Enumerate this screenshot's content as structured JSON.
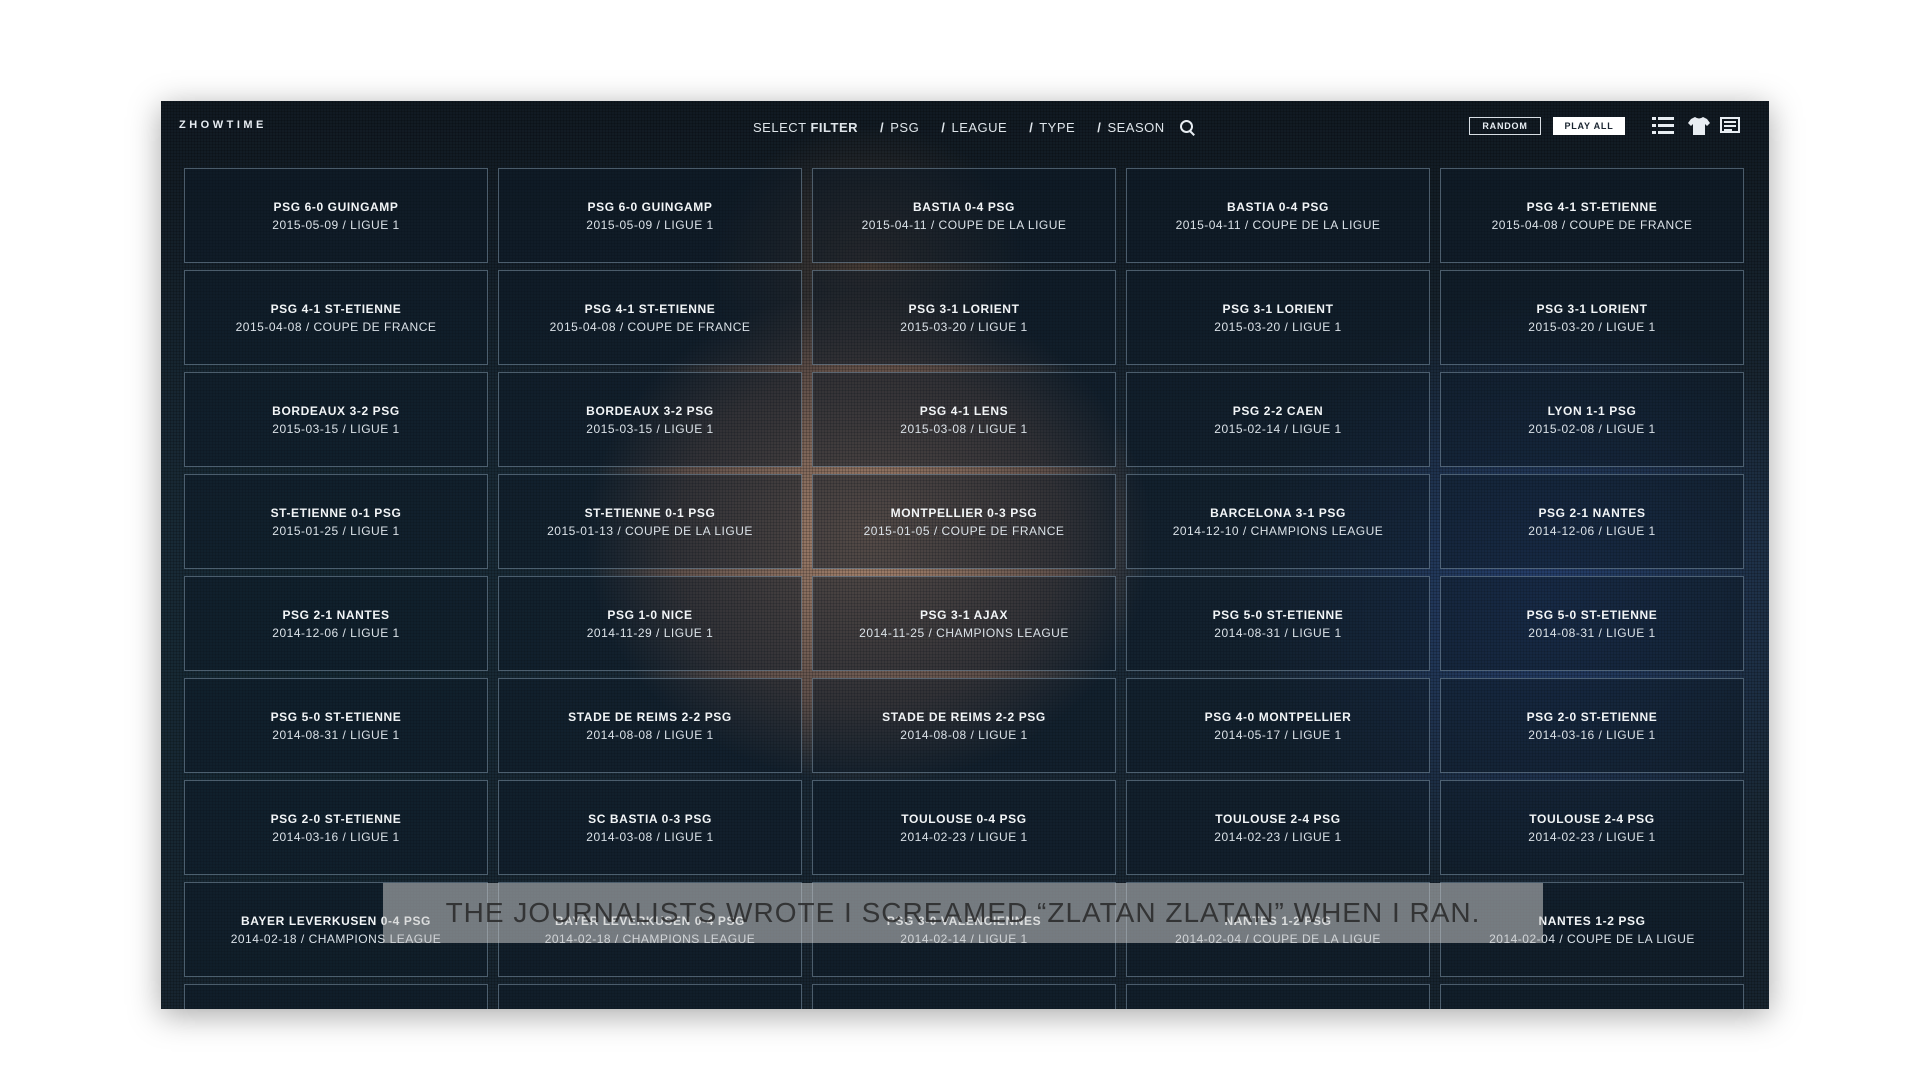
{
  "header": {
    "logo": "ZHOWTIME",
    "select_label": "SELECT",
    "filter_label": "FILTER",
    "filters": [
      "PSG",
      "LEAGUE",
      "TYPE",
      "SEASON"
    ],
    "random_label": "RANDOM",
    "play_all_label": "PLAY ALL",
    "icons": [
      "search-icon",
      "list-view-icon",
      "shirt-icon",
      "article-icon"
    ]
  },
  "subtitle": "THE JOURNALISTS WROTE I SCREAMED “ZLATAN ZLATAN” WHEN I RAN.",
  "matches": [
    {
      "title": "PSG 6-0 GUINGAMP",
      "meta": "2015-05-09 / LIGUE 1"
    },
    {
      "title": "PSG 6-0 GUINGAMP",
      "meta": "2015-05-09 / LIGUE 1"
    },
    {
      "title": "BASTIA 0-4 PSG",
      "meta": "2015-04-11 / COUPE DE LA LIGUE"
    },
    {
      "title": "BASTIA 0-4 PSG",
      "meta": "2015-04-11 / COUPE DE LA LIGUE"
    },
    {
      "title": "PSG 4-1 ST-ETIENNE",
      "meta": "2015-04-08 / COUPE DE FRANCE"
    },
    {
      "title": "PSG 4-1 ST-ETIENNE",
      "meta": "2015-04-08 / COUPE DE FRANCE"
    },
    {
      "title": "PSG 4-1 ST-ETIENNE",
      "meta": "2015-04-08 / COUPE DE FRANCE"
    },
    {
      "title": "PSG 3-1 LORIENT",
      "meta": "2015-03-20 / LIGUE 1"
    },
    {
      "title": "PSG 3-1 LORIENT",
      "meta": "2015-03-20 / LIGUE 1"
    },
    {
      "title": "PSG 3-1 LORIENT",
      "meta": "2015-03-20 / LIGUE 1"
    },
    {
      "title": "BORDEAUX 3-2 PSG",
      "meta": "2015-03-15 / LIGUE 1"
    },
    {
      "title": "BORDEAUX 3-2 PSG",
      "meta": "2015-03-15 / LIGUE 1"
    },
    {
      "title": "PSG 4-1 LENS",
      "meta": "2015-03-08 / LIGUE 1"
    },
    {
      "title": "PSG 2-2 CAEN",
      "meta": "2015-02-14 / LIGUE 1"
    },
    {
      "title": "LYON 1-1 PSG",
      "meta": "2015-02-08 / LIGUE 1"
    },
    {
      "title": "ST-ETIENNE 0-1 PSG",
      "meta": "2015-01-25 / LIGUE 1"
    },
    {
      "title": "ST-ETIENNE 0-1 PSG",
      "meta": "2015-01-13 / COUPE DE LA LIGUE"
    },
    {
      "title": "MONTPELLIER 0-3 PSG",
      "meta": "2015-01-05 / COUPE DE FRANCE"
    },
    {
      "title": "BARCELONA 3-1 PSG",
      "meta": "2014-12-10 / CHAMPIONS LEAGUE"
    },
    {
      "title": "PSG 2-1 NANTES",
      "meta": "2014-12-06 / LIGUE 1"
    },
    {
      "title": "PSG 2-1 NANTES",
      "meta": "2014-12-06 / LIGUE 1"
    },
    {
      "title": "PSG 1-0 NICE",
      "meta": "2014-11-29 / LIGUE 1"
    },
    {
      "title": "PSG 3-1 AJAX",
      "meta": "2014-11-25 / CHAMPIONS LEAGUE"
    },
    {
      "title": "PSG 5-0 ST-ETIENNE",
      "meta": "2014-08-31 / LIGUE 1"
    },
    {
      "title": "PSG 5-0 ST-ETIENNE",
      "meta": "2014-08-31 / LIGUE 1"
    },
    {
      "title": "PSG 5-0 ST-ETIENNE",
      "meta": "2014-08-31 / LIGUE 1"
    },
    {
      "title": "STADE DE REIMS 2-2 PSG",
      "meta": "2014-08-08 / LIGUE 1"
    },
    {
      "title": "STADE DE REIMS 2-2 PSG",
      "meta": "2014-08-08 / LIGUE 1"
    },
    {
      "title": "PSG 4-0 MONTPELLIER",
      "meta": "2014-05-17 / LIGUE 1"
    },
    {
      "title": "PSG 2-0 ST-ETIENNE",
      "meta": "2014-03-16 / LIGUE 1"
    },
    {
      "title": "PSG 2-0 ST-ETIENNE",
      "meta": "2014-03-16 / LIGUE 1"
    },
    {
      "title": "SC BASTIA 0-3 PSG",
      "meta": "2014-03-08 / LIGUE 1"
    },
    {
      "title": "TOULOUSE 0-4 PSG",
      "meta": "2014-02-23 / LIGUE 1"
    },
    {
      "title": "TOULOUSE 2-4 PSG",
      "meta": "2014-02-23 / LIGUE 1"
    },
    {
      "title": "TOULOUSE 2-4 PSG",
      "meta": "2014-02-23 / LIGUE 1"
    },
    {
      "title": "BAYER LEVERKUSEN 0-4 PSG",
      "meta": "2014-02-18 / CHAMPIONS LEAGUE"
    },
    {
      "title": "BAYER LEVERKUSEN 0-4 PSG",
      "meta": "2014-02-18 / CHAMPIONS LEAGUE"
    },
    {
      "title": "PSG 3-0 VALENCIENNES",
      "meta": "2014-02-14 / LIGUE 1"
    },
    {
      "title": "NANTES 1-2 PSG",
      "meta": "2014-02-04 / COUPE DE LA LIGUE"
    },
    {
      "title": "NANTES 1-2 PSG",
      "meta": "2014-02-04 / COUPE DE LA LIGUE"
    },
    {
      "title": "",
      "meta": ""
    },
    {
      "title": "",
      "meta": ""
    },
    {
      "title": "",
      "meta": ""
    },
    {
      "title": "",
      "meta": ""
    },
    {
      "title": "",
      "meta": ""
    }
  ]
}
